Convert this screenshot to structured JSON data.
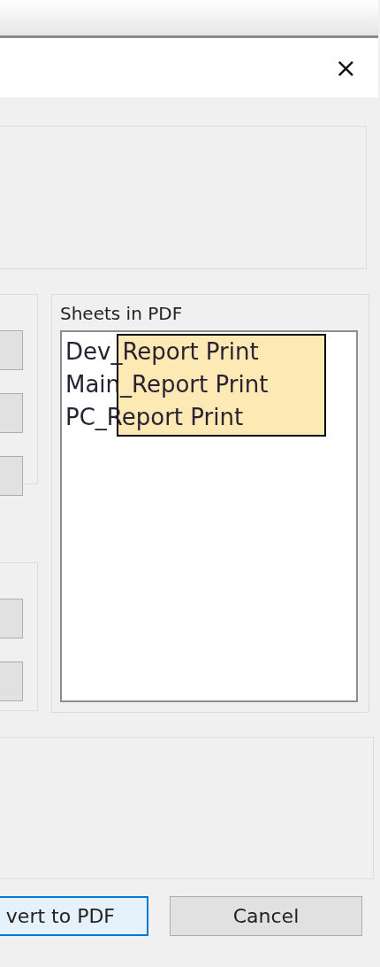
{
  "window": {
    "close_label": "×"
  },
  "sheets_group": {
    "label": "Sheets in PDF",
    "items": [
      "Dev_Report Print",
      "Main_Report Print",
      "PC_Report Print"
    ]
  },
  "buttons": [
    {
      "label": "vert to PDF",
      "kind": "default"
    },
    {
      "label": "Cancel",
      "kind": "normal"
    }
  ]
}
